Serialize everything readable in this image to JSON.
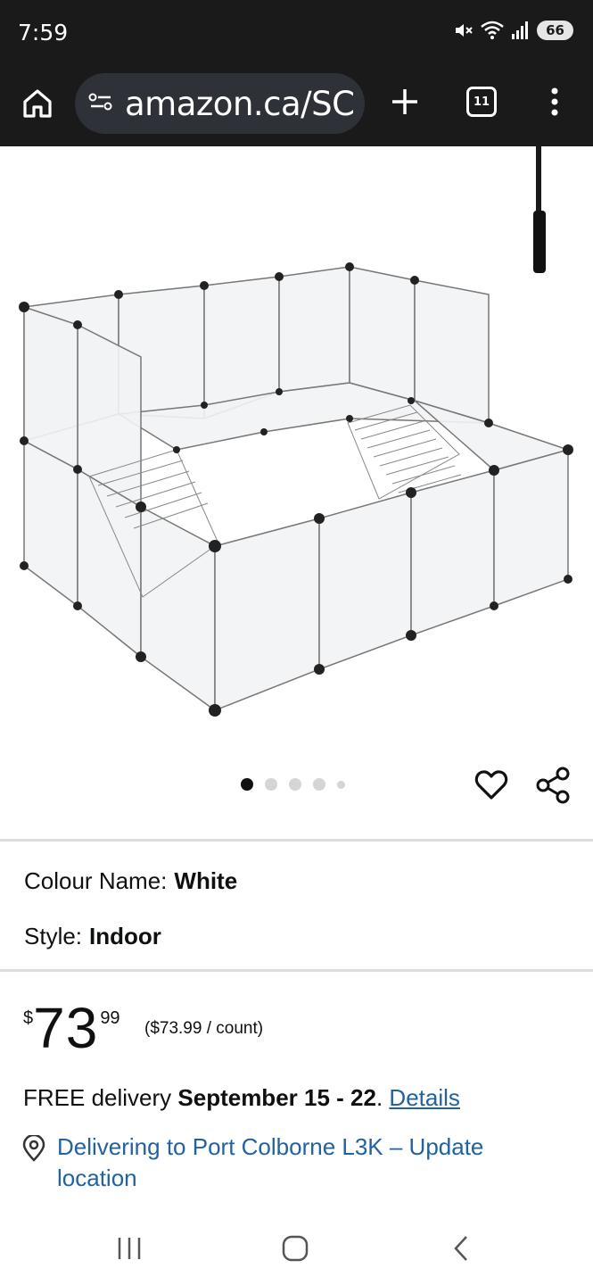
{
  "status_bar": {
    "time": "7:59",
    "battery": "66",
    "icons": [
      "mute-icon",
      "wifi-icon",
      "signal-icon",
      "battery-icon"
    ]
  },
  "browser": {
    "url": "amazon.ca/SC",
    "tab_count": "11",
    "icons": [
      "home-icon",
      "site-settings-icon",
      "new-tab-icon",
      "tabs-icon",
      "more-menu-icon"
    ]
  },
  "product": {
    "image_alt_icon": "pet-playpen-image",
    "carousel": {
      "count": 5,
      "active_index": 0
    },
    "actions": [
      "heart-icon",
      "share-icon"
    ],
    "colour": {
      "label": "Colour Name:",
      "value": "White"
    },
    "style": {
      "label": "Style:",
      "value": "Indoor"
    },
    "price": {
      "symbol": "$",
      "whole": "73",
      "fraction": "99",
      "per_unit": "($73.99 / count)"
    },
    "delivery": {
      "prefix": "FREE delivery",
      "dates": "September 15 - 22",
      "period": ".",
      "details_link": "Details"
    },
    "location": {
      "text": "Delivering to Port Colborne L3K – Update location",
      "icon": "location-pin-icon"
    }
  },
  "navbar": {
    "icons": [
      "recents-icon",
      "home-nav-icon",
      "back-icon"
    ]
  },
  "colors": {
    "status_bg": "#1a1a1a",
    "url_bg": "#2e3137",
    "link": "#2162a1",
    "text": "#0f1111"
  }
}
